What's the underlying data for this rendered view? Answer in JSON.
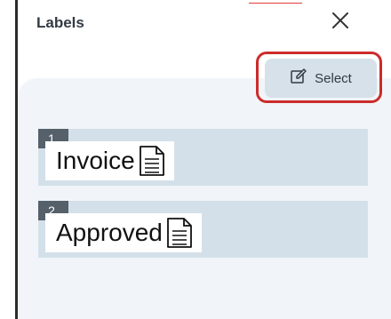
{
  "header": {
    "title": "Labels"
  },
  "toolbar": {
    "select_label": "Select"
  },
  "labels": [
    {
      "number": "1",
      "text": "Invoice"
    },
    {
      "number": "2",
      "text": "Approved"
    }
  ],
  "colors": {
    "highlight": "#cc2b2b",
    "select_bg": "#d6e1e9",
    "row_bg": "#d4e0e9",
    "badge_bg": "#56606a"
  },
  "icons": {
    "close": "close-icon",
    "select": "edit-icon",
    "label_doc": "document-icon"
  }
}
